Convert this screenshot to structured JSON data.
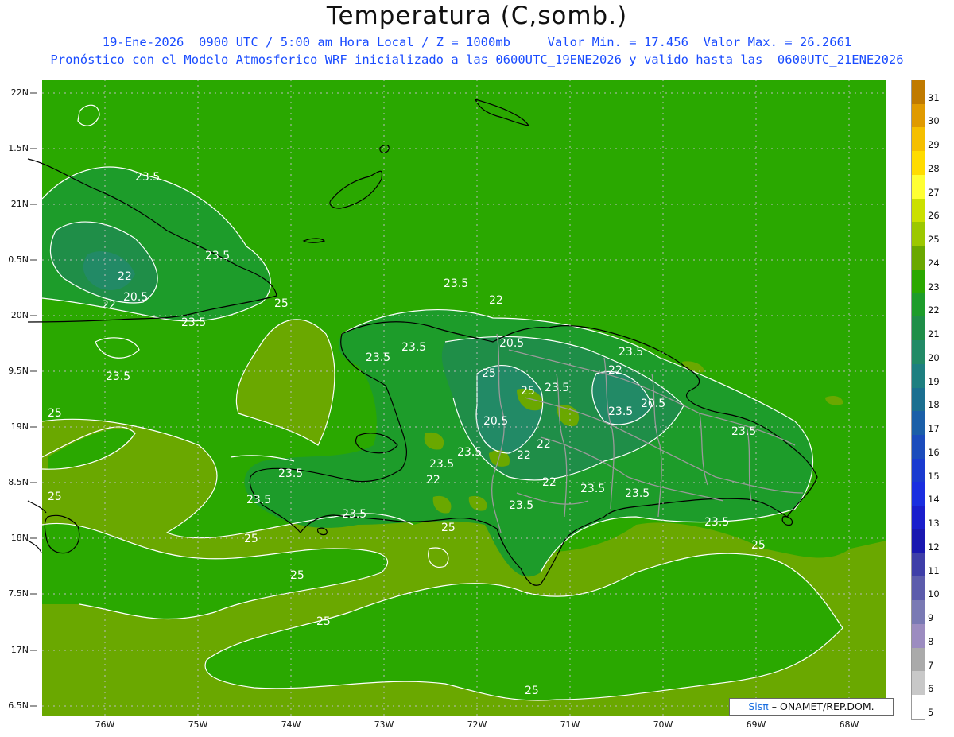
{
  "title": "Temperatura (C,somb.)",
  "subtitle1": "19-Ene-2026  0900 UTC / 5:00 am Hora Local / Z = 1000mb     Valor Min. = 17.456  Valor Max. = 26.2661",
  "subtitle2": "Pronóstico con el Modelo Atmosferico WRF inicializado a las 0600UTC_19ENE2026 y valido hasta las  0600UTC_21ENE2026",
  "y_ticks": [
    "22N",
    "1.5N",
    "21N",
    "0.5N",
    "20N",
    "9.5N",
    "19N",
    "8.5N",
    "18N",
    "7.5N",
    "17N",
    "6.5N"
  ],
  "x_ticks": [
    "76W",
    "75W",
    "74W",
    "73W",
    "72W",
    "71W",
    "70W",
    "69W",
    "68W"
  ],
  "colorbar": {
    "labels": [
      "31",
      "30",
      "29",
      "28",
      "27",
      "26",
      "25",
      "24",
      "23",
      "22",
      "21",
      "20",
      "19",
      "18",
      "17",
      "16",
      "15",
      "14",
      "13",
      "12",
      "11",
      "10",
      "9",
      "8",
      "7",
      "6",
      "5"
    ],
    "colors": [
      "#c07a00",
      "#e09a00",
      "#f5bf00",
      "#ffdc00",
      "#ffff33",
      "#cbe000",
      "#9cc800",
      "#6aa800",
      "#2aa800",
      "#1d9c2a",
      "#1f8e48",
      "#228a66",
      "#1e7f80",
      "#1b6f90",
      "#1b5fa8",
      "#1b4cbc",
      "#1a3bd0",
      "#1a2ee0",
      "#1a1ecc",
      "#1a18b0",
      "#3e3ea8",
      "#5c5cac",
      "#7a7ab4",
      "#9c8cc0",
      "#aaaaaa",
      "#c8c8c8",
      "#ffffff"
    ]
  },
  "contour_labels": [
    "23.5",
    "23.5",
    "22",
    "22",
    "20.5",
    "23.5",
    "25",
    "23.5",
    "25",
    "23.5",
    "22",
    "23.5",
    "23.5",
    "20.5",
    "23.5",
    "23.5",
    "22",
    "25",
    "23.5",
    "20.5",
    "22",
    "23.5",
    "22",
    "20.5",
    "23.5",
    "25",
    "23.5",
    "23.5",
    "22",
    "23.5",
    "23.5",
    "25",
    "22",
    "23.5",
    "23.5",
    "23.5",
    "25",
    "25",
    "25",
    "25",
    "25",
    "25",
    "23.5"
  ],
  "colors": {
    "sea": "#6aa800",
    "land": "#2aa800",
    "mid": "#1d9c2a",
    "cool": "#1f8e48",
    "cold": "#228a66",
    "contour": "#ffffff",
    "coast": "#000000",
    "border": "#9a9a9a"
  },
  "credit": {
    "brand": "Sisπ",
    "text": "– ONAMET/REP.DOM."
  }
}
